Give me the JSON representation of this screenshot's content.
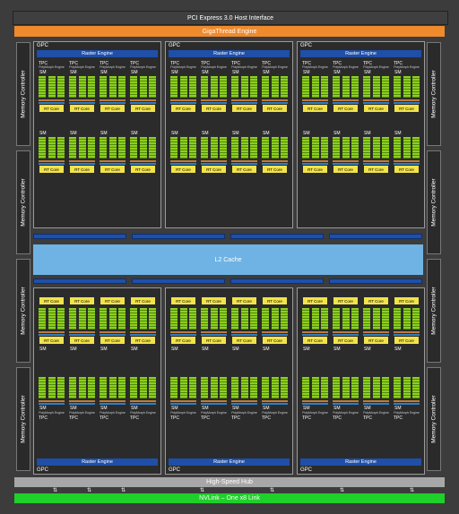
{
  "top_bar": {
    "label": "PCI Express 3.0 Host Interface"
  },
  "gigathread": {
    "label": "GigaThread Engine"
  },
  "memory_controller": {
    "label": "Memory Controller"
  },
  "gpc_label": "GPC",
  "raster_engine": "Raster Engine",
  "tpc_label": "TPC",
  "polymorph": "PolyMorph Engine",
  "sm_label": "SM",
  "rt_core": "RT Core",
  "l2_cache": {
    "label": "L2 Cache"
  },
  "hub": {
    "label": "High-Speed Hub"
  },
  "nvlink": {
    "label": "NVLink – One x8 Link"
  },
  "colors": {
    "background": "#3c3c3c",
    "host_bar": "#3f3f3f",
    "gigathread": "#ef8a2d",
    "raster": "#1f4fa8",
    "sm_green": "#8fce1f",
    "rt_core": "#f2e34a",
    "l2": "#6fb3e4",
    "hub": "#a7a7a7",
    "nvlink": "#1fcf2a"
  }
}
